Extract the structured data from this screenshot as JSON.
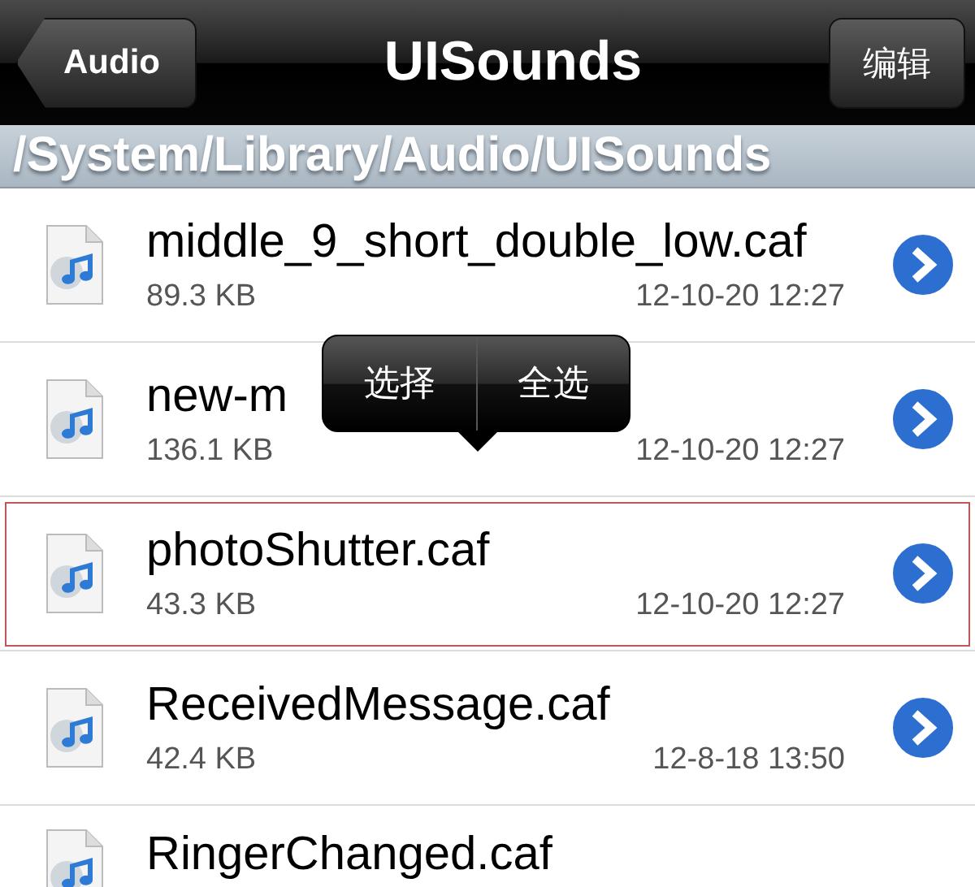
{
  "nav_bar": {
    "back_button": "Audio",
    "title": "UISounds",
    "edit_button": "编辑"
  },
  "path_bar": {
    "path": "/System/Library/Audio/UISounds"
  },
  "files": [
    {
      "name": "middle_9_short_double_low.caf",
      "size": "89.3 KB",
      "date": "12-10-20 12:27",
      "selected": false
    },
    {
      "name": "new-m",
      "size": "136.1 KB",
      "date": "12-10-20 12:27",
      "selected": false
    },
    {
      "name": "photoShutter.caf",
      "size": "43.3 KB",
      "date": "12-10-20 12:27",
      "selected": true
    },
    {
      "name": "ReceivedMessage.caf",
      "size": "42.4 KB",
      "date": "12-8-18 13:50",
      "selected": false
    },
    {
      "name": "RingerChanged.caf",
      "selected": false
    }
  ],
  "edit_menu": {
    "items": [
      "选择",
      "全选"
    ]
  }
}
